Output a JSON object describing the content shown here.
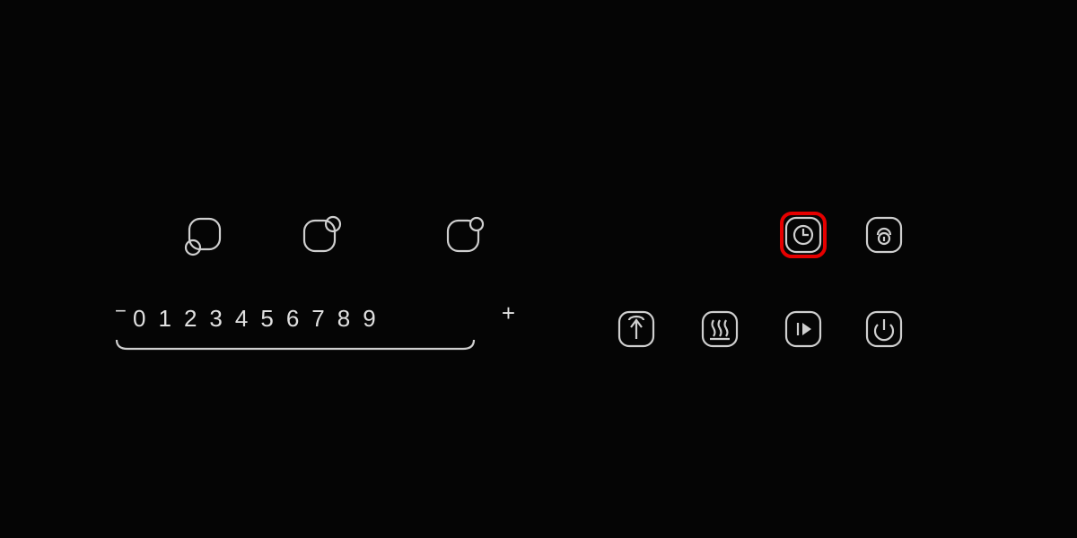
{
  "zones": [
    {
      "name": "zone-front-left"
    },
    {
      "name": "zone-rear-left"
    },
    {
      "name": "zone-rear-right"
    }
  ],
  "slider": {
    "minus": "−",
    "plus": "+",
    "digits": [
      "0",
      "1",
      "2",
      "3",
      "4",
      "5",
      "6",
      "7",
      "8",
      "9"
    ]
  },
  "functions_top": [
    {
      "name": "timer",
      "highlighted": true
    },
    {
      "name": "lock",
      "highlighted": false
    }
  ],
  "functions_bottom": [
    {
      "name": "boost"
    },
    {
      "name": "keep-warm"
    },
    {
      "name": "pause-play"
    },
    {
      "name": "power"
    }
  ],
  "colors": {
    "highlight": "#e60000",
    "stroke": "#cfcfcf",
    "bg": "#050505"
  }
}
